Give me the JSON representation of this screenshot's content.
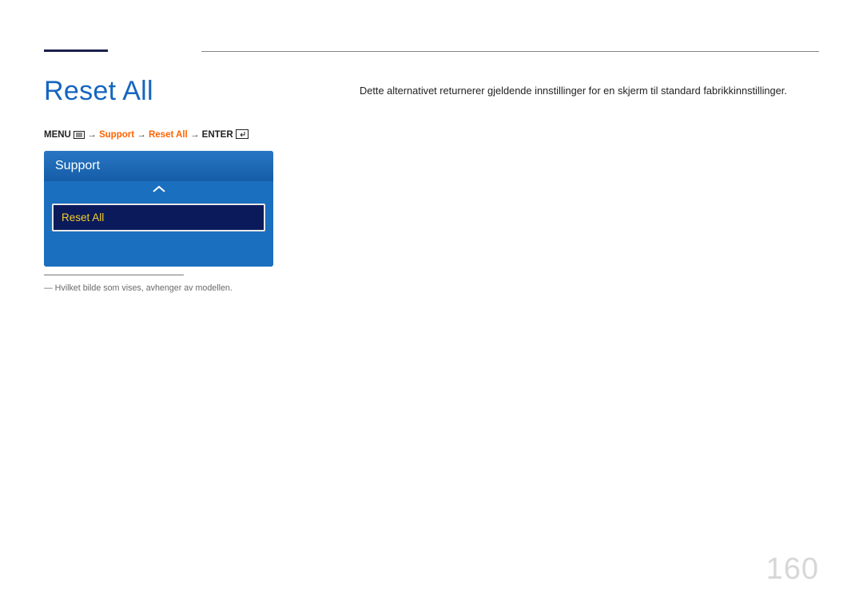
{
  "heading": "Reset All",
  "breadcrumb": {
    "menu_label": "MENU",
    "support": "Support",
    "reset_all": "Reset All",
    "enter_label": "ENTER",
    "arrow": "→"
  },
  "menu_card": {
    "header": "Support",
    "item": "Reset All"
  },
  "footnote": "― Hvilket bilde som vises, avhenger av modellen.",
  "description": "Dette alternativet returnerer gjeldende innstillinger for en skjerm til standard fabrikkinnstillinger.",
  "page_number": "160"
}
